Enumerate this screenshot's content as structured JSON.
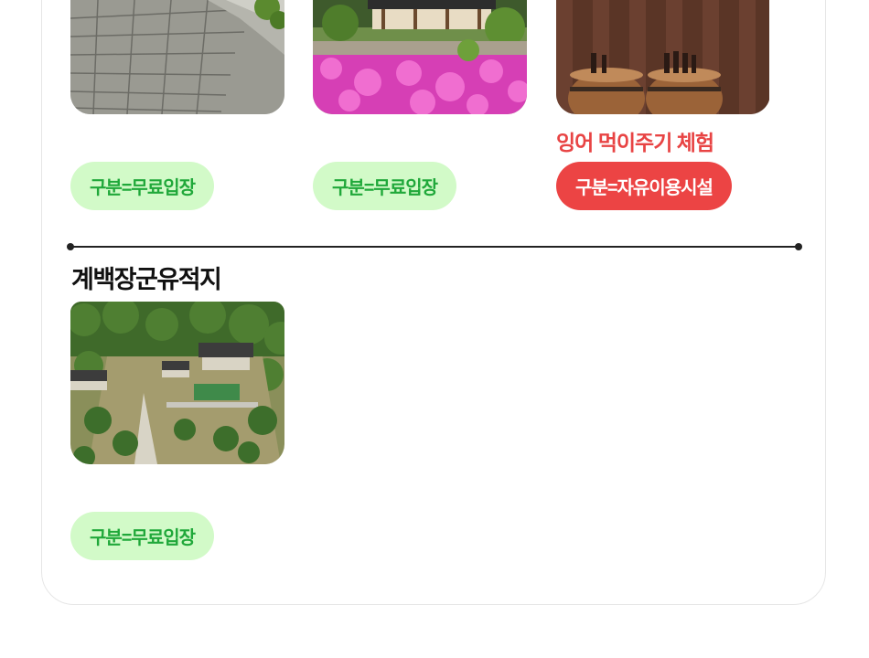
{
  "row1": {
    "cards": [
      {
        "image": "stone-wall-photo",
        "caption": "",
        "badge": "구분=무료입장",
        "badge_type": "free"
      },
      {
        "image": "hanok-azalea-garden-photo",
        "caption": "",
        "badge": "구분=무료입장",
        "badge_type": "free"
      },
      {
        "image": "wine-barrels-photo",
        "caption": "잉어 먹이주기 체험",
        "badge": "구분=자유이용시설",
        "badge_type": "facility"
      }
    ]
  },
  "section2": {
    "title": "계백장군유적지",
    "cards": [
      {
        "image": "gyebaek-memorial-aerial-photo",
        "caption": "",
        "badge": "구분=무료입장",
        "badge_type": "free"
      }
    ]
  },
  "colors": {
    "free_badge_bg": "#d2fac8",
    "free_badge_text": "#20a83a",
    "facility_badge_bg": "#ec4444",
    "facility_badge_text": "#ffffff",
    "caption_red": "#e84444"
  }
}
